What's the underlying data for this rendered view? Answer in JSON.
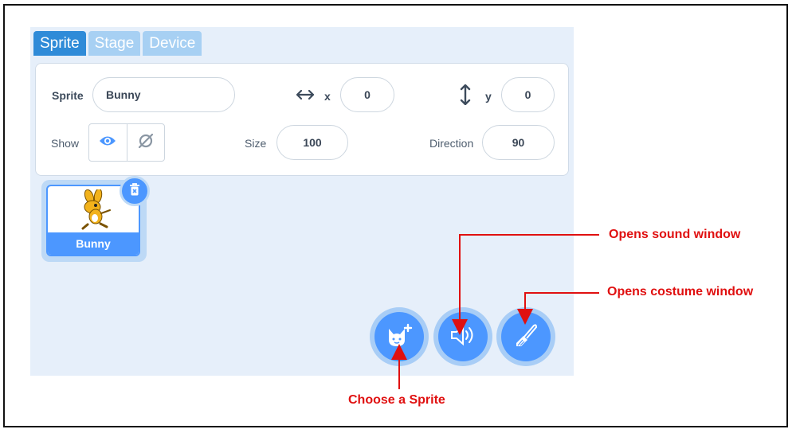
{
  "tabs": [
    "Sprite",
    "Stage",
    "Device"
  ],
  "sprite_info": {
    "sprite_label": "Sprite",
    "sprite_name": "Bunny",
    "x_label": "x",
    "x_value": "0",
    "y_label": "y",
    "y_value": "0",
    "show_label": "Show",
    "size_label": "Size",
    "size_value": "100",
    "direction_label": "Direction",
    "direction_value": "90"
  },
  "sprite_list": [
    {
      "name": "Bunny",
      "selected": true
    }
  ],
  "annotations": {
    "sound": "Opens sound window",
    "costume": "Opens costume window",
    "choose": "Choose a Sprite"
  },
  "colors": {
    "accent": "#4c97ff",
    "annotation": "#e01010"
  },
  "icons": [
    "eye-icon",
    "eye-hidden-icon",
    "horizontal-arrows-icon",
    "vertical-arrows-icon",
    "trash-icon",
    "cat-plus-icon",
    "speaker-icon",
    "paintbrush-icon"
  ]
}
